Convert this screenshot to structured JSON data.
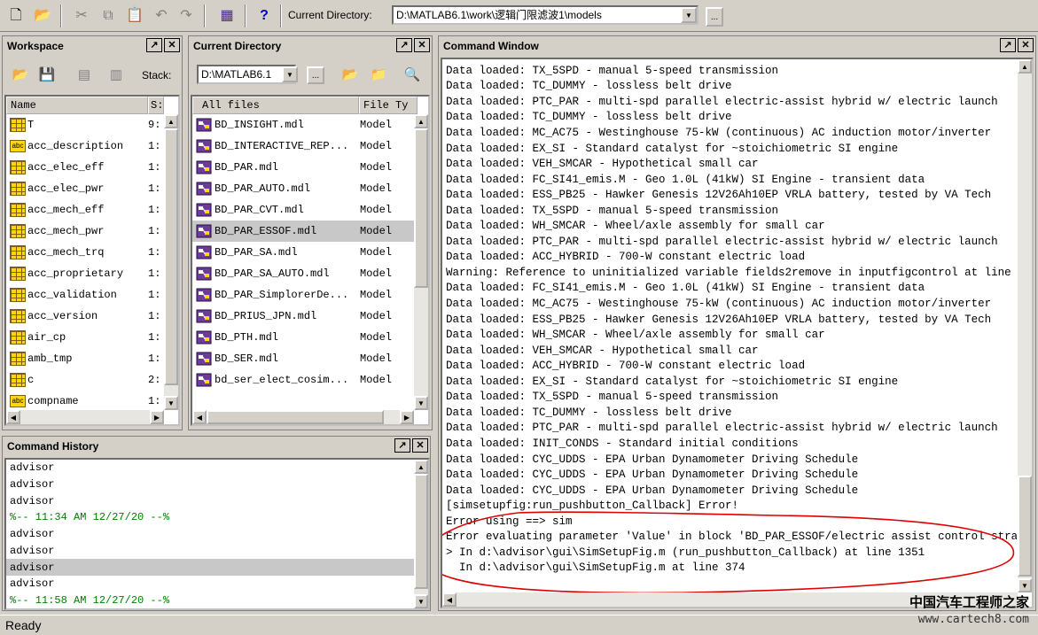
{
  "toolbar": {
    "current_directory_label": "Current Directory:",
    "current_directory_value": "D:\\MATLAB6.1\\work\\逻辑门限滤波1\\models",
    "browse_label": "...",
    "help_label": "?"
  },
  "workspace": {
    "title": "Workspace",
    "stack_label": "Stack:",
    "col_name": "Name",
    "col_size": "S:",
    "items": [
      {
        "name": "T",
        "size": "9:",
        "icon": "grid-icon"
      },
      {
        "name": "acc_description",
        "size": "1:",
        "icon": "abc-icon"
      },
      {
        "name": "acc_elec_eff",
        "size": "1:",
        "icon": "grid-icon"
      },
      {
        "name": "acc_elec_pwr",
        "size": "1:",
        "icon": "grid-icon"
      },
      {
        "name": "acc_mech_eff",
        "size": "1:",
        "icon": "grid-icon"
      },
      {
        "name": "acc_mech_pwr",
        "size": "1:",
        "icon": "grid-icon"
      },
      {
        "name": "acc_mech_trq",
        "size": "1:",
        "icon": "grid-icon"
      },
      {
        "name": "acc_proprietary",
        "size": "1:",
        "icon": "grid-icon"
      },
      {
        "name": "acc_validation",
        "size": "1:",
        "icon": "grid-icon"
      },
      {
        "name": "acc_version",
        "size": "1:",
        "icon": "grid-icon"
      },
      {
        "name": "air_cp",
        "size": "1:",
        "icon": "grid-icon"
      },
      {
        "name": "amb_tmp",
        "size": "1:",
        "icon": "grid-icon"
      },
      {
        "name": "c",
        "size": "2:",
        "icon": "grid-icon"
      },
      {
        "name": "compname",
        "size": "1:",
        "icon": "abc-icon"
      }
    ]
  },
  "current_directory": {
    "title": "Current Directory",
    "path_short": "D:\\MATLAB6.1",
    "col_files": "All files",
    "col_type": "File Ty",
    "files": [
      {
        "name": "BD_INSIGHT.mdl",
        "type": "Model"
      },
      {
        "name": "BD_INTERACTIVE_REP...",
        "type": "Model"
      },
      {
        "name": "BD_PAR.mdl",
        "type": "Model"
      },
      {
        "name": "BD_PAR_AUTO.mdl",
        "type": "Model"
      },
      {
        "name": "BD_PAR_CVT.mdl",
        "type": "Model"
      },
      {
        "name": "BD_PAR_ESSOF.mdl",
        "type": "Model"
      },
      {
        "name": "BD_PAR_SA.mdl",
        "type": "Model"
      },
      {
        "name": "BD_PAR_SA_AUTO.mdl",
        "type": "Model"
      },
      {
        "name": "BD_PAR_SimplorerDe...",
        "type": "Model"
      },
      {
        "name": "BD_PRIUS_JPN.mdl",
        "type": "Model"
      },
      {
        "name": "BD_PTH.mdl",
        "type": "Model"
      },
      {
        "name": "BD_SER.mdl",
        "type": "Model"
      },
      {
        "name": "bd_ser_elect_cosim...",
        "type": "Model"
      }
    ],
    "selected_index": 5
  },
  "command_history": {
    "title": "Command History",
    "lines": [
      "advisor",
      "advisor",
      "advisor",
      "%-- 11:34 AM 12/27/20 --%",
      "advisor",
      "advisor",
      "advisor",
      "advisor",
      "%-- 11:58 AM 12/27/20 --%"
    ],
    "selected_index": 6
  },
  "command_window": {
    "title": "Command Window",
    "lines": [
      "Data loaded: TX_5SPD - manual 5-speed transmission",
      "Data loaded: TC_DUMMY - lossless belt drive",
      "Data loaded: PTC_PAR - multi-spd parallel electric-assist hybrid w/ electric launch",
      "Data loaded: TC_DUMMY - lossless belt drive",
      "Data loaded: MC_AC75 - Westinghouse 75-kW (continuous) AC induction motor/inverter",
      "Data loaded: EX_SI - Standard catalyst for ~stoichiometric SI engine",
      "Data loaded: VEH_SMCAR - Hypothetical small car",
      "Data loaded: FC_SI41_emis.M - Geo 1.0L (41kW) SI Engine - transient data",
      "Data loaded: ESS_PB25 - Hawker Genesis 12V26Ah10EP VRLA battery, tested by VA Tech",
      "Data loaded: TX_5SPD - manual 5-speed transmission",
      "Data loaded: WH_SMCAR - Wheel/axle assembly for small car",
      "Data loaded: PTC_PAR - multi-spd parallel electric-assist hybrid w/ electric launch",
      "Data loaded: ACC_HYBRID - 700-W constant electric load",
      "Warning: Reference to uninitialized variable fields2remove in inputfigcontrol at line",
      "Data loaded: FC_SI41_emis.M - Geo 1.0L (41kW) SI Engine - transient data",
      "Data loaded: MC_AC75 - Westinghouse 75-kW (continuous) AC induction motor/inverter",
      "Data loaded: ESS_PB25 - Hawker Genesis 12V26Ah10EP VRLA battery, tested by VA Tech",
      "Data loaded: WH_SMCAR - Wheel/axle assembly for small car",
      "Data loaded: VEH_SMCAR - Hypothetical small car",
      "Data loaded: ACC_HYBRID - 700-W constant electric load",
      "Data loaded: EX_SI - Standard catalyst for ~stoichiometric SI engine",
      "Data loaded: TX_5SPD - manual 5-speed transmission",
      "Data loaded: TC_DUMMY - lossless belt drive",
      "Data loaded: PTC_PAR - multi-spd parallel electric-assist hybrid w/ electric launch",
      "Data loaded: INIT_CONDS - Standard initial conditions",
      "Data loaded: CYC_UDDS - EPA Urban Dynamometer Driving Schedule",
      "Data loaded: CYC_UDDS - EPA Urban Dynamometer Driving Schedule",
      "Data loaded: CYC_UDDS - EPA Urban Dynamometer Driving Schedule",
      "[simsetupfig:run_pushbutton_Callback] Error!",
      "Error using ==> sim",
      "Error evaluating parameter 'Value' in block 'BD_PAR_ESSOF/electric assist control stra",
      "> In d:\\advisor\\gui\\SimSetupFig.m (run_pushbutton_Callback) at line 1351",
      "  In d:\\advisor\\gui\\SimSetupFig.m at line 374",
      "",
      ">>"
    ],
    "highlight_color": "#e00000"
  },
  "status": {
    "text": "Ready"
  },
  "watermark": {
    "line1": "中国汽车工程师之家",
    "line2": "www.cartech8.com"
  }
}
